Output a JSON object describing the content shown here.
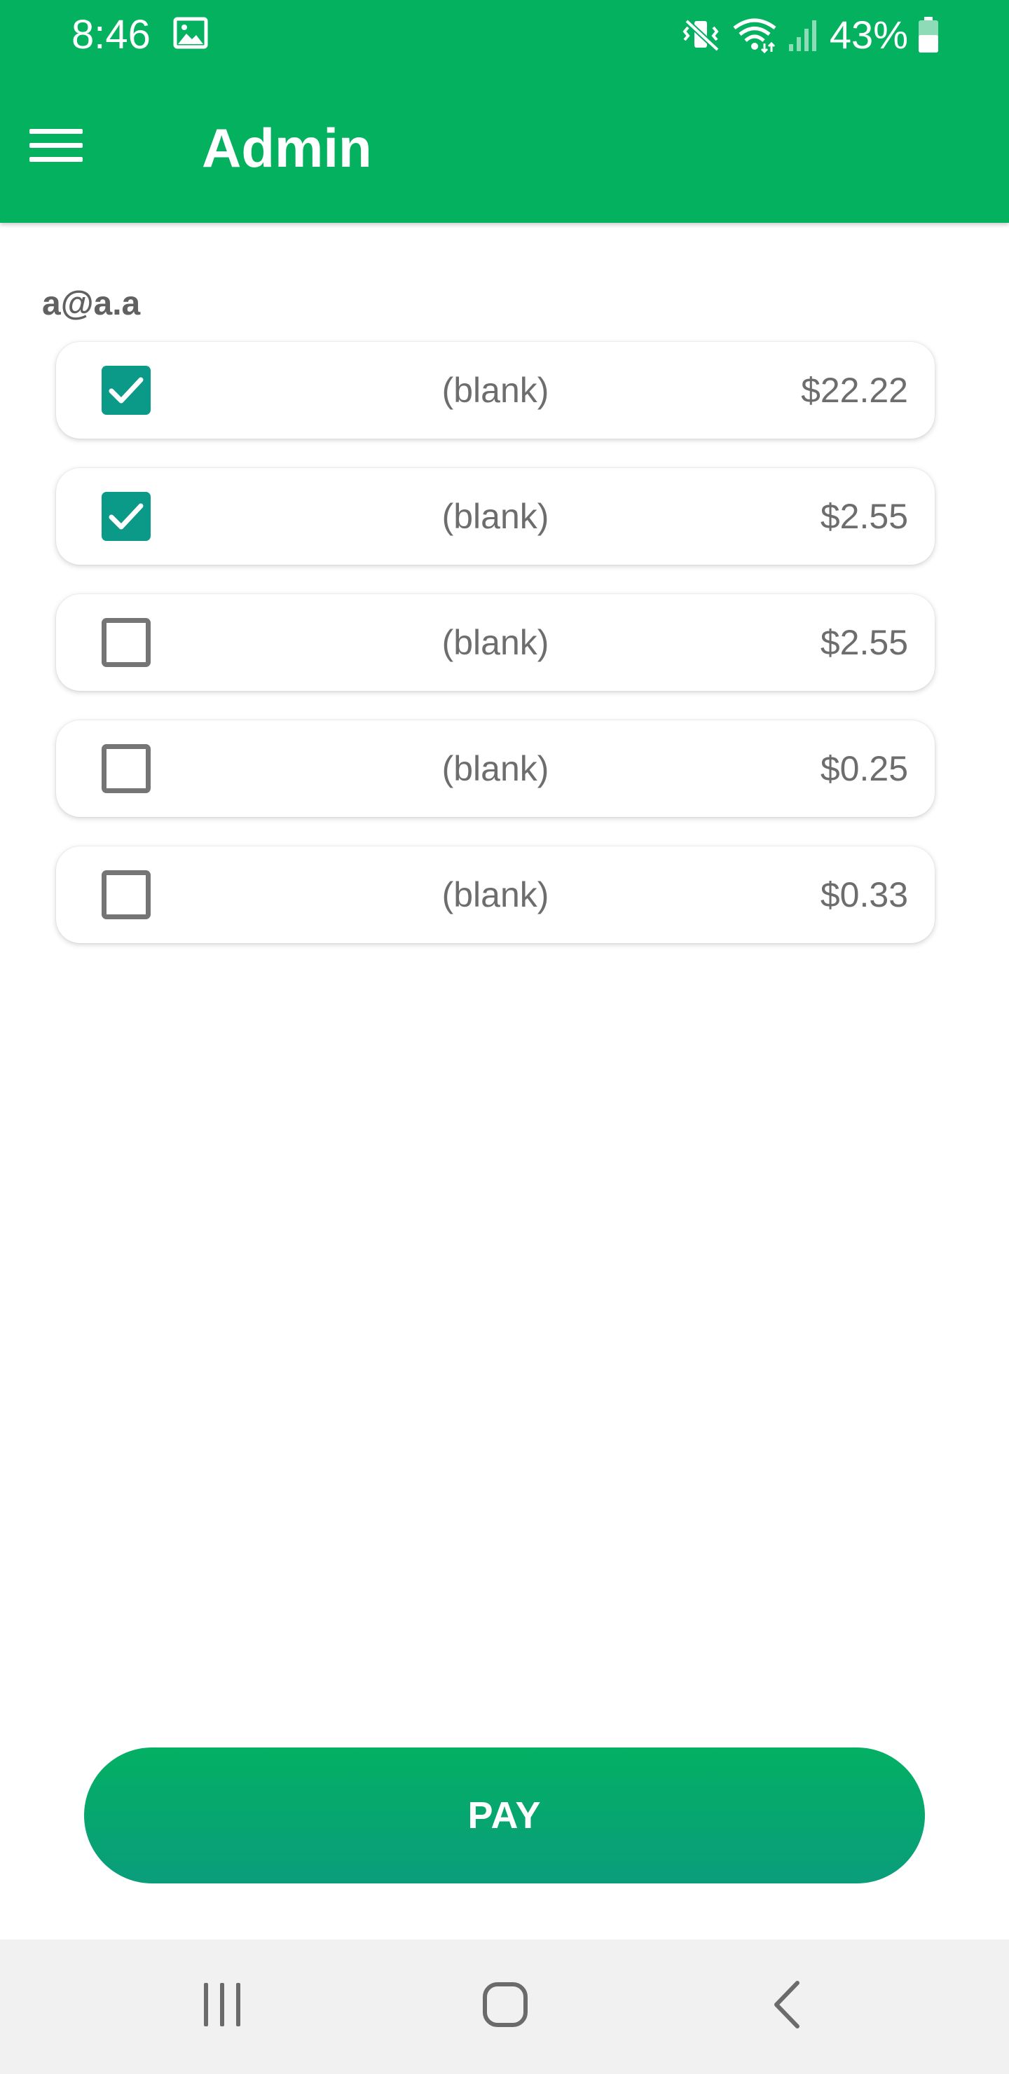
{
  "status_bar": {
    "time": "8:46",
    "battery_percent": "43%",
    "icons": [
      "gallery-icon",
      "mute-vibrate-icon",
      "wifi-icon",
      "signal-icon",
      "battery-icon"
    ]
  },
  "app_bar": {
    "title": "Admin",
    "menu_icon": "menu-icon"
  },
  "user_email": "a@a.a",
  "bills": [
    {
      "description": "(blank)",
      "amount": "$22.22",
      "checked": true
    },
    {
      "description": "(blank)",
      "amount": "$2.55",
      "checked": true
    },
    {
      "description": "(blank)",
      "amount": "$2.55",
      "checked": false
    },
    {
      "description": "(blank)",
      "amount": "$0.25",
      "checked": false
    },
    {
      "description": "(blank)",
      "amount": "$0.33",
      "checked": false
    }
  ],
  "pay_button": {
    "label": "PAY"
  },
  "nav_bar": {
    "icons": [
      "recents-icon",
      "home-icon",
      "back-icon"
    ]
  },
  "colors": {
    "brand_green": "#03b15f",
    "checkbox_checked": "#0b9a87",
    "text_gray": "#6d6d6d"
  }
}
